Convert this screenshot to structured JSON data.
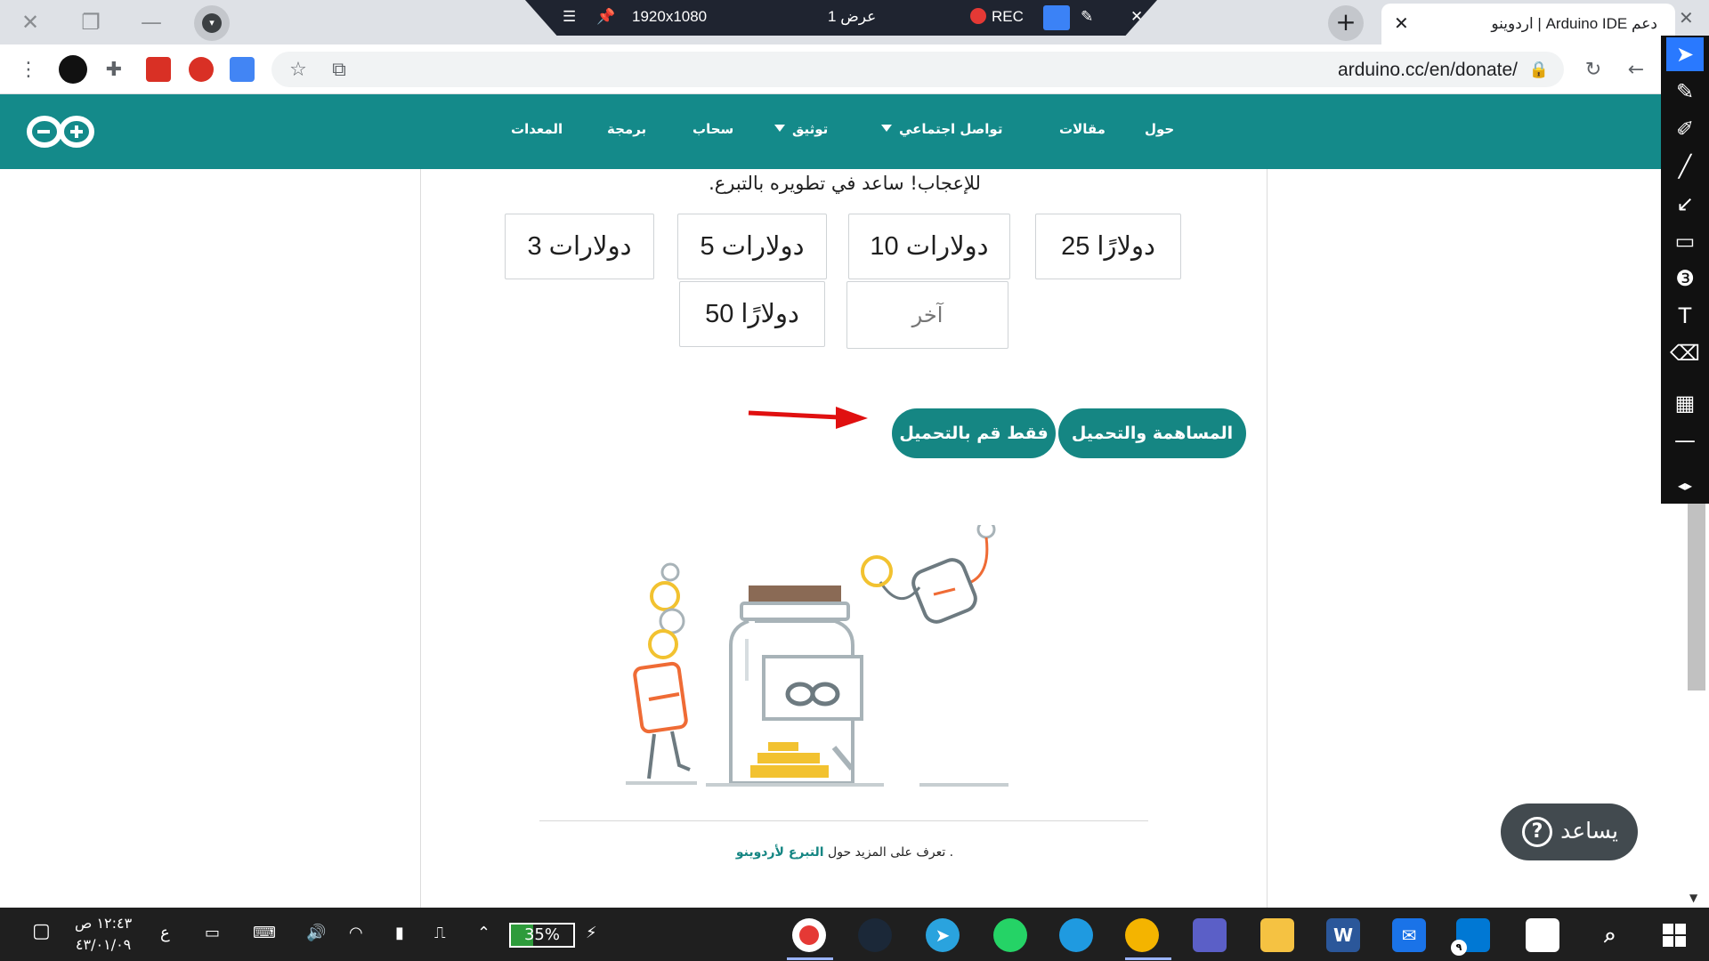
{
  "browser": {
    "tab_title": "دعم Arduino IDE | اردوينو",
    "url": "arduino.cc/en/donate/",
    "new_tab_label": "+",
    "close_tab_label": "✕"
  },
  "recorder": {
    "resolution": "1920x1080",
    "view_label": "عرض 1",
    "rec_label": "REC"
  },
  "site": {
    "nav": [
      "حول",
      "مقالات",
      "تواصل اجتماعي",
      "توثيق",
      "سحاب",
      "برمجة",
      "المعدات"
    ]
  },
  "donate": {
    "intro": "للإعجاب! ساعد في تطويره بالتبرع.",
    "amounts": [
      "دولارًا 25",
      "دولارات 10",
      "دولارات 5",
      "دولارات 3",
      "دولارًا 50"
    ],
    "other_placeholder": "آخر",
    "contribute_button": "المساهمة والتحميل",
    "download_button": "فقط قم بالتحميل",
    "learn_prefix": ". تعرف على المزيد حول ",
    "learn_link": "التبرع لأردوينو"
  },
  "help": {
    "label": "يساعد",
    "icon_glyph": "?"
  },
  "taskbar": {
    "time": "١٢:٤٣ ص",
    "date": "٤٣/٠١/٠٩",
    "lang": "ع",
    "battery": "35%",
    "battery_level": 0.35,
    "store_badge": "٩"
  },
  "colors": {
    "header": "#148a8a",
    "button": "#158683",
    "arrow": "#e01010"
  }
}
